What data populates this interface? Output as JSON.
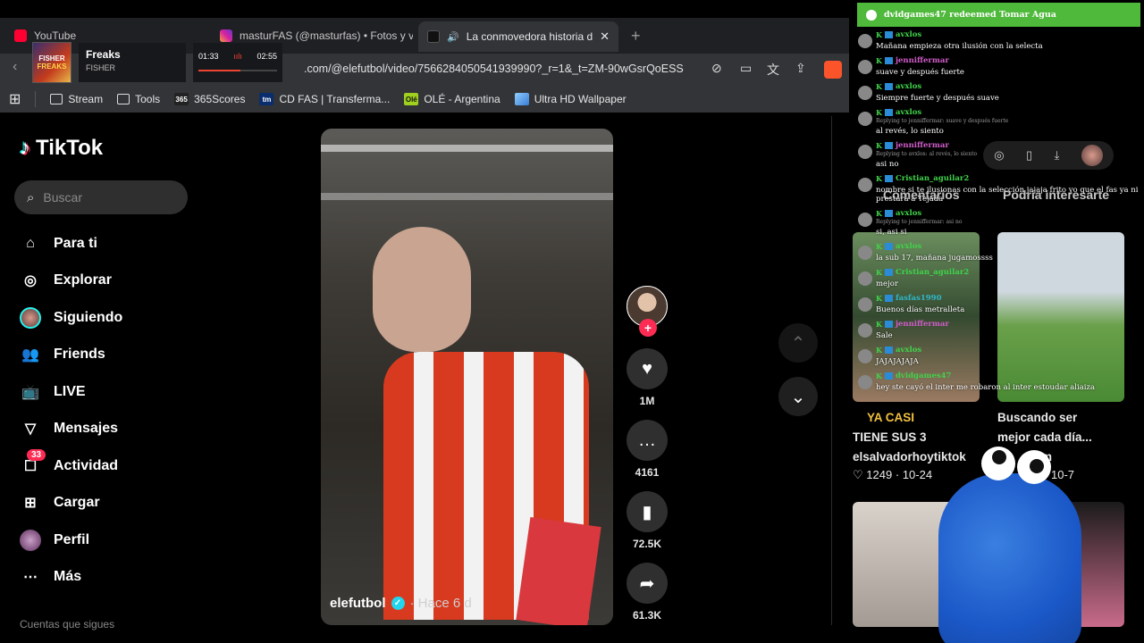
{
  "browser": {
    "tabs": [
      {
        "title": "YouTube",
        "icon_color": "#ff0033"
      },
      {
        "title": "masturFAS (@masturfas) • Fotos y vic",
        "icon_color": "#d6249f"
      },
      {
        "title": "La conmovedora historia de",
        "icon_color": "#111111"
      }
    ],
    "url": ".com/@elefutbol/video/7566284050541939990?_r=1&_t=ZM-90wGsrQoESS",
    "bookmarks": [
      "Stream",
      "Tools",
      "365Scores",
      "CD FAS | Transferma...",
      "OLÉ - Argentina",
      "Ultra HD Wallpaper"
    ]
  },
  "media_overlay": {
    "cover_text_top": "FISHER",
    "cover_text_bottom": "FREAKS",
    "track": "Freaks",
    "artist": "FISHER",
    "elapsed": "01:33",
    "duration": "02:55",
    "progress": 0.53
  },
  "tiktok": {
    "logo": "TikTok",
    "search_placeholder": "Buscar",
    "nav": [
      {
        "label": "Para ti",
        "icon": "home-icon"
      },
      {
        "label": "Explorar",
        "icon": "compass-icon"
      },
      {
        "label": "Siguiendo",
        "icon": "following-avatar-icon"
      },
      {
        "label": "Friends",
        "icon": "friends-icon"
      },
      {
        "label": "LIVE",
        "icon": "live-tv-icon"
      },
      {
        "label": "Mensajes",
        "icon": "send-icon"
      },
      {
        "label": "Actividad",
        "icon": "inbox-icon",
        "badge": "33"
      },
      {
        "label": "Cargar",
        "icon": "upload-plus-icon"
      },
      {
        "label": "Perfil",
        "icon": "profile-avatar-icon"
      },
      {
        "label": "Más",
        "icon": "more-dots-icon"
      }
    ],
    "footnote": "Cuentas que sigues",
    "video": {
      "handle": "elefutbol",
      "posted": "· Hace 6 d"
    },
    "actions": {
      "likes": "1M",
      "comments": "4161",
      "saves": "72.5K",
      "shares": "61.3K"
    },
    "right_panel": {
      "tab_comments": "Comentarios",
      "tab_suggested": "Podría interesarte",
      "cards": [
        {
          "caption": "YA CASI",
          "extra": "TIENE SUS 3",
          "author": "elsalvadorhoytiktok",
          "likes": "1249",
          "date": "10-24"
        },
        {
          "caption": "Buscando ser",
          "extra": "mejor cada día...",
          "author": "llem",
          "likes": "",
          "date": "10-7"
        }
      ]
    }
  },
  "chat": {
    "redeem": "dvidgames47 redeemed Tomar Agua",
    "messages": [
      {
        "user": "avxlos",
        "color": "#3fd34a",
        "reply": "",
        "text": "Mañana empieza otra ilusión con la selecta"
      },
      {
        "user": "jenniffermar",
        "color": "#d05cc9",
        "reply": "",
        "text": "suave y después fuerte"
      },
      {
        "user": "avxlos",
        "color": "#3fd34a",
        "reply": "",
        "text": "Siempre fuerte y después suave"
      },
      {
        "user": "avxlos",
        "color": "#3fd34a",
        "reply": "Replying to jenniffermar: suave y después fuerte",
        "text": "al revés, lo siento"
      },
      {
        "user": "jenniffermar",
        "color": "#d05cc9",
        "reply": "Replying to avxlos: al revés, lo siento",
        "text": "asi no"
      },
      {
        "user": "Cristian_aguilar2",
        "color": "#3fd34a",
        "reply": "",
        "text": "nombre si te ilusionas con la selección jajaja frito yo que el fas ya ni prestará a Tejada"
      },
      {
        "user": "avxlos",
        "color": "#3fd34a",
        "reply": "Replying to jenniffermar: asi no",
        "text": "si, asi si"
      },
      {
        "user": "avxlos",
        "color": "#3fd34a",
        "reply": "",
        "text": "la sub 17, mañana jugamossss"
      },
      {
        "user": "Cristian_aguilar2",
        "color": "#3fd34a",
        "reply": "",
        "text": "mejor"
      },
      {
        "user": "fasfas1990",
        "color": "#2fb6c9",
        "reply": "",
        "text": "Buenos días metralleta"
      },
      {
        "user": "jenniffermar",
        "color": "#d05cc9",
        "reply": "",
        "text": "Sale"
      },
      {
        "user": "avxlos",
        "color": "#3fd34a",
        "reply": "",
        "text": "JAJAJAJAJA"
      },
      {
        "user": "dvidgames47",
        "color": "#3fd34a",
        "reply": "",
        "text": "hey ste cayó el inter me robaron al inter estoudar aliaiza"
      }
    ]
  }
}
